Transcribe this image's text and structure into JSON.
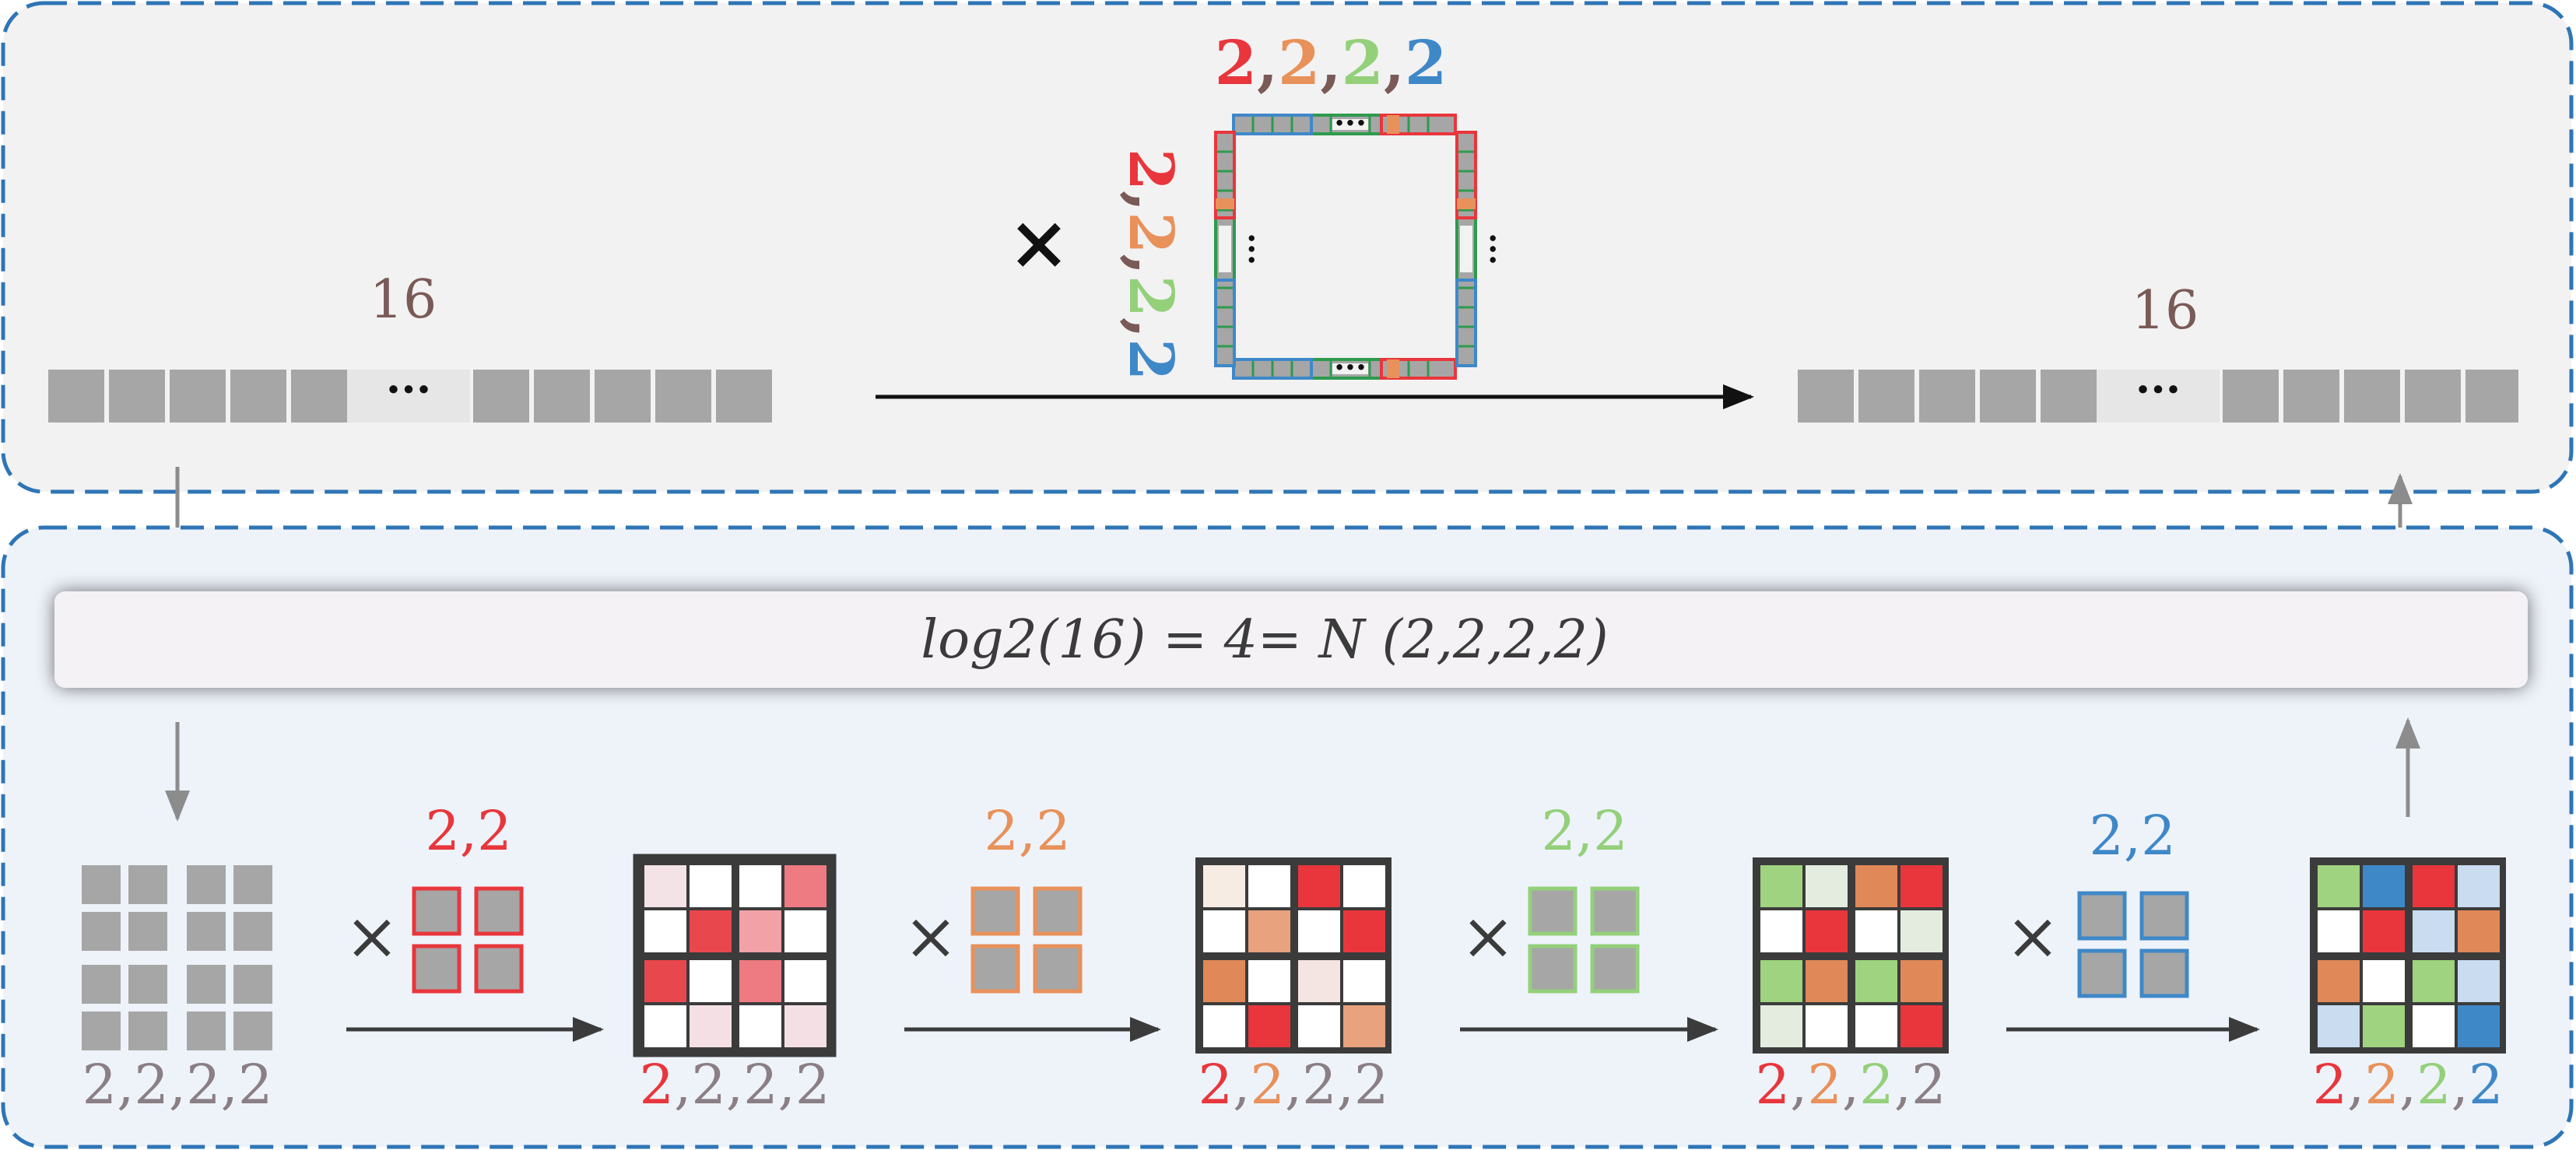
{
  "colors": {
    "red": "#e8363c",
    "orange": "#e8915a",
    "green": "#94d07a",
    "blue": "#3f88c8",
    "gray_cell": "#a6a6a6",
    "text_gray": "#8a7f84",
    "brown": "#7a5a57",
    "panel_top": "#f2f2f2",
    "panel_bottom": "#eef3fa",
    "border": "#2e75b6",
    "dark": "#3b3b3b"
  },
  "top": {
    "left_count": "16",
    "right_count": "16",
    "ellipsis": "···",
    "times": "×",
    "matrix_top_dims": [
      "2",
      ",",
      "2",
      ",",
      "2",
      ",",
      "2"
    ],
    "matrix_side_dims": [
      "2",
      ",",
      "2",
      ",",
      "2",
      ",",
      "2"
    ]
  },
  "banner": {
    "formula": "log2(16) = 4= N (2,2,2,2)"
  },
  "bottom": {
    "times": "×",
    "start_label": "2,2,2,2",
    "factors": [
      {
        "label": "2,2",
        "color": "red"
      },
      {
        "label": "2,2",
        "color": "orange"
      },
      {
        "label": "2,2",
        "color": "green"
      },
      {
        "label": "2,2",
        "color": "blue"
      }
    ],
    "stage_labels": [
      [
        "2",
        ",2,2,2"
      ],
      [
        "2",
        ",",
        "2",
        ",2,2"
      ],
      [
        "2",
        ",",
        "2",
        ",",
        "2",
        ",2"
      ],
      [
        "2",
        ",",
        "2",
        ",",
        "2",
        ",",
        "2"
      ]
    ]
  }
}
